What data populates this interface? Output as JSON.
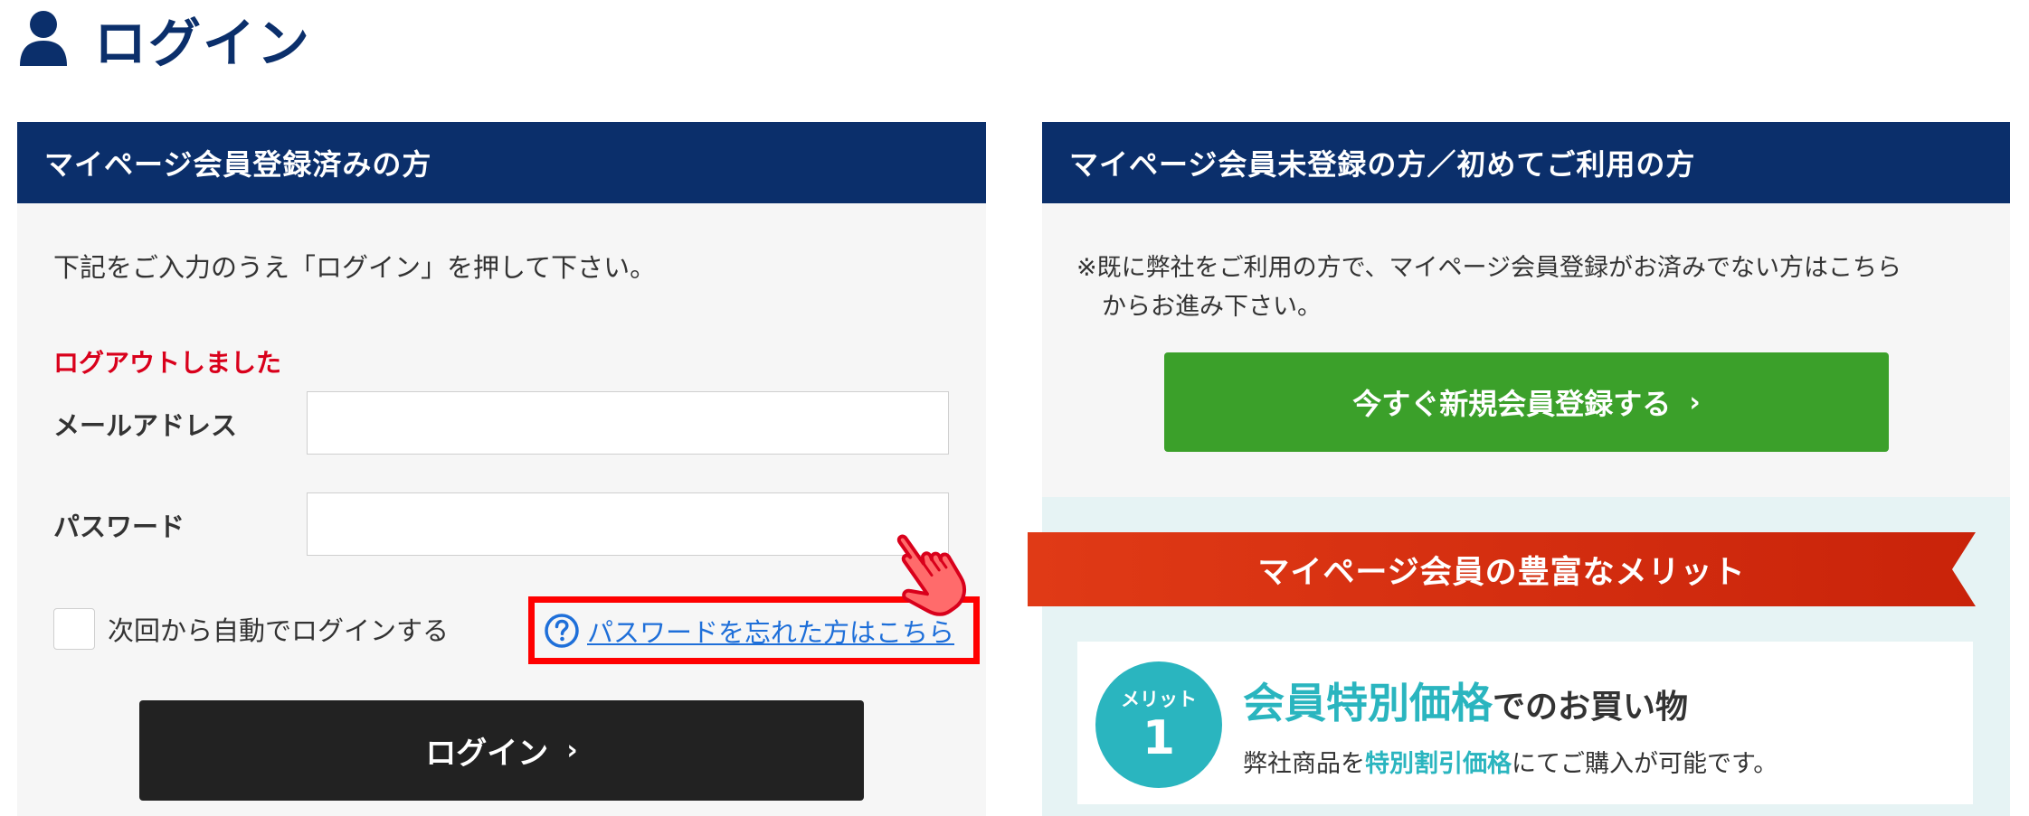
{
  "page": {
    "title": "ログイン",
    "title_icon": "person-icon"
  },
  "colors": {
    "navy": "#0b2f6b",
    "panel_bg": "#f6f6f6",
    "error_red": "#d9001b",
    "highlight_red": "#ff0000",
    "link_blue": "#1e6fd9",
    "login_button_bg": "#222222",
    "register_button_bg": "#3ba02a",
    "ribbon_red": "#e03a16",
    "teal": "#2ab5bf",
    "merit_bg": "#e6f3f4"
  },
  "login_panel": {
    "header": "マイページ会員登録済みの方",
    "instruction": "下記をご入力のうえ「ログイン」を押して下さい。",
    "logout_message": "ログアウトしました",
    "email_label": "メールアドレス",
    "email_value": "",
    "password_label": "パスワード",
    "password_value": "",
    "remember_label": "次回から自動でログインする",
    "remember_checked": false,
    "forgot_icon": "help-circle-icon",
    "forgot_link": "パスワードを忘れた方はこちら",
    "pointer_icon": "hand-pointer-icon",
    "login_button": "ログイン",
    "login_button_icon": "chevron-right-icon"
  },
  "register_panel": {
    "header": "マイページ会員未登録の方／初めてご利用の方",
    "note_line1": "※既に弊社をご利用の方で、マイページ会員登録がお済みでない方はこちら",
    "note_line2": "からお進み下さい。",
    "register_button": "今すぐ新規会員登録する",
    "register_button_icon": "chevron-right-icon"
  },
  "merits": {
    "ribbon_title": "マイページ会員の豊富なメリット",
    "items": [
      {
        "badge_label": "メリット",
        "badge_number": "1",
        "heading_highlight": "会員特別価格",
        "heading_rest": "でのお買い物",
        "desc_prefix": "弊社商品を",
        "desc_highlight": "特別割引価格",
        "desc_suffix": "にてご購入が可能です。"
      }
    ]
  }
}
